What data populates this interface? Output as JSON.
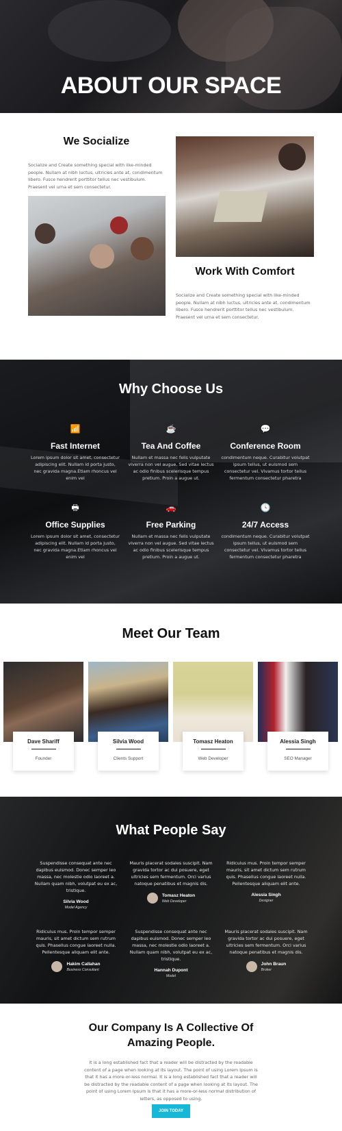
{
  "hero": {
    "title": "ABOUT OUR SPACE"
  },
  "about": {
    "socialize": {
      "title": "We Socialize",
      "text": "Socialize and Create something special with like-minded people. Nullam at nibh luctus, ultricies ante at, condimentum libero. Fusce hendrerit porttitor tellus nec vestibulum. Praesent vel urna et sem consectetur."
    },
    "comfort": {
      "title": "Work With Comfort",
      "text": "Socialize and Create something special with like-minded people. Nullam at nibh luctus, ultricies ante at, condimentum libero. Fusce hendrerit porttitor tellus nec vestibulum. Praesent vel urna et sem consectetur."
    }
  },
  "why": {
    "title": "Why Choose Us",
    "features": [
      {
        "icon": "wifi-icon",
        "glyph": "📶",
        "title": "Fast Internet",
        "text": "Lorem ipsum dolor sit amet, consectetur adipiscing elit. Nullam id porta justo, nec gravida magna.Etiam rhoncus vel enim vel"
      },
      {
        "icon": "coffee-icon",
        "glyph": "☕",
        "title": "Tea And Coffee",
        "text": "Nullam et massa nec felis vulputate viverra non vel augue. Sed vitae lectus ac odio finibus scelerisque tempus pretium. Proin a augue ut."
      },
      {
        "icon": "chat-icon",
        "glyph": "💬",
        "title": "Conference Room",
        "text": "condimentum neque. Curabitur volutpat ipsum tellus, ut euismod sem consectetur vel. Vivamus tortor tellus fermentum consectetur pharetra"
      },
      {
        "icon": "printer-icon",
        "glyph": "🖶",
        "title": "Office Supplies",
        "text": "Lorem ipsum dolor sit amet, consectetur adipiscing elit. Nullam id porta justo, nec gravida magna.Etiam rhoncus vel enim vel"
      },
      {
        "icon": "car-icon",
        "glyph": "🚗",
        "title": "Free Parking",
        "text": "Nullam et massa nec felis vulputate viverra non vel augue. Sed vitae lectus ac odio finibus scelerisque tempus pretium. Proin a augue ut."
      },
      {
        "icon": "clock-icon",
        "glyph": "🕓",
        "title": "24/7 Access",
        "text": "condimentum neque. Curabitur volutpat ipsum tellus, ut euismod sem consectetur vel. Vivamus tortor tellus fermentum consectetur pharetra"
      }
    ]
  },
  "team": {
    "title": "Meet Our Team",
    "members": [
      {
        "name": "Dave Shariff",
        "role": "Founder"
      },
      {
        "name": "Silvia Wood",
        "role": "Clients Support"
      },
      {
        "name": "Tomasz Heaton",
        "role": "Web Developer"
      },
      {
        "name": "Alessia Singh",
        "role": "SEO Manager"
      }
    ]
  },
  "testimonials": {
    "title": "What People Say",
    "items": [
      {
        "text": "Suspendisse consequat ante nec dapibus euismod. Donec semper leo massa, nec molestie odio laoreet a. Nullam quam nibh, volutpat eu ex ac, tristique.",
        "name": "Silvia Wood",
        "role": "Model Agency"
      },
      {
        "text": "Mauris placerat sodales suscipit. Nam gravida tortor ac dui posuere, eget ultricies sem fermentum. Orci varius natoque penatibus et magnis dis.",
        "name": "Tomasz Heaton",
        "role": "Web Developer"
      },
      {
        "text": "Ridiculus mus. Proin tempor semper mauris, sit amet dictum sem rutrum quis. Phasellus congue laoreet nulla. Pellentesque aliquam elit ante.",
        "name": "Alessia Singh",
        "role": "Designer"
      },
      {
        "text": "Ridiculus mus. Proin tempor semper mauris, sit amet dictum sem rutrum quis. Phasellus congue laoreet nulla. Pellentesque aliquam elit ante.",
        "name": "Hakim Callahan",
        "role": "Business Consultant"
      },
      {
        "text": "Suspendisse consequat ante nec dapibus euismod. Donec semper leo massa, nec molestie odio laoreet a. Nullam quam nibh, volutpat eu ex ac, tristique.",
        "name": "Hannah Dupont",
        "role": "Model"
      },
      {
        "text": "Mauris placerat sodales suscipit. Nam gravida tortor ac dui posuere, eget ultricies sem fermentum. Orci varius natoque penatibus et magnis dis.",
        "name": "John Braun",
        "role": "Broker"
      }
    ]
  },
  "company": {
    "title_line1": "Our Company Is A Collective Of",
    "title_line2": "Amazing People.",
    "text": "It is a long established fact that a reader will be distracted by the readable content of a page when looking at its layout. The point of using Lorem Ipsum is that it has a more-or-less normal. It is a long established fact that a reader will be distracted by the readable content of a page when looking at its layout. The point of using Lorem Ipsum is that it has a more-or-less normal distribution of letters, as opposed to using.",
    "button": "JOIN TODAY",
    "button_color": "#17b8d6"
  }
}
